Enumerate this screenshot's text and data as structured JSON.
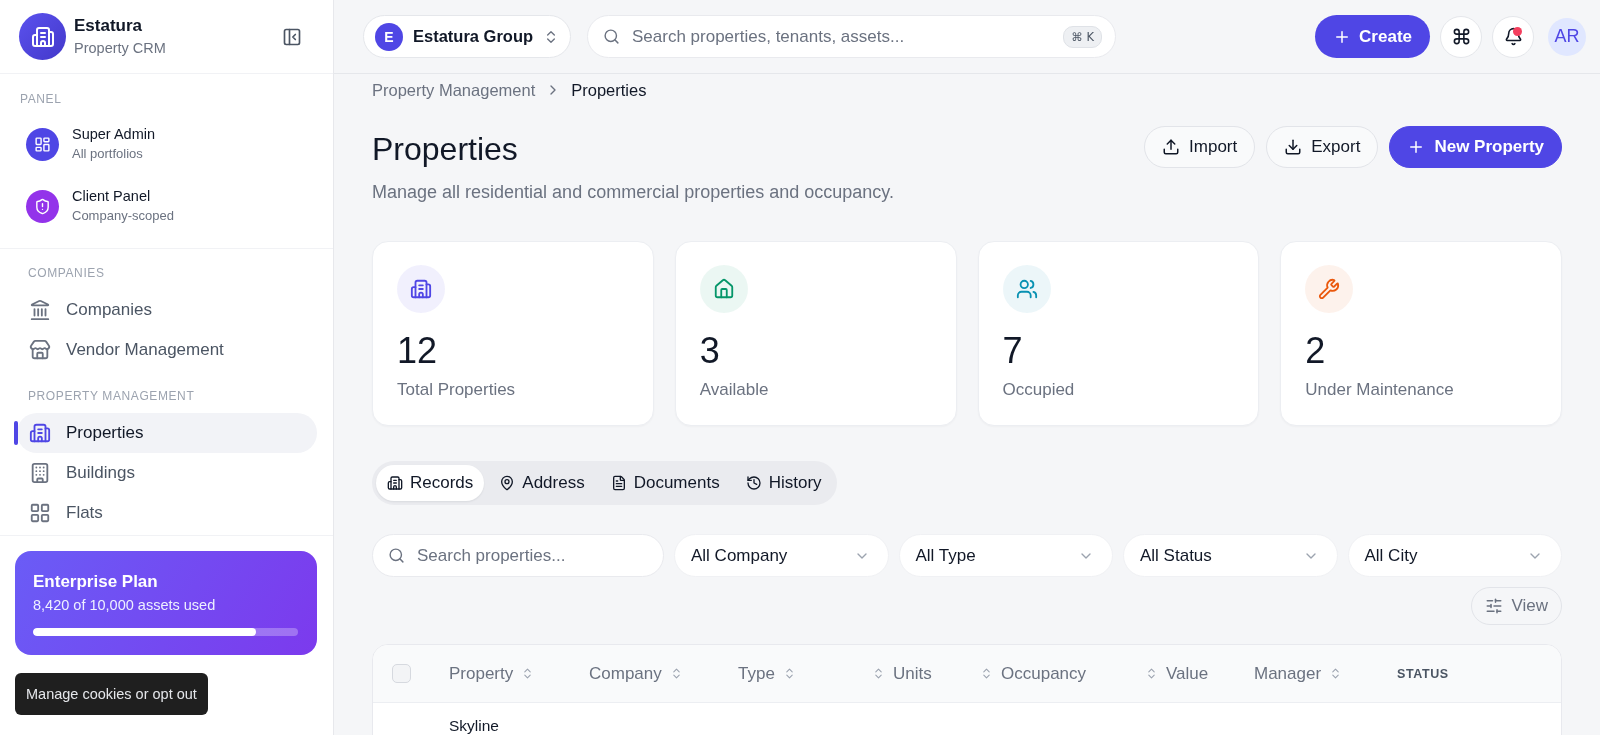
{
  "sidebar": {
    "brand": {
      "name": "Estatura",
      "subtitle": "Property CRM"
    },
    "panel_section": {
      "label": "PANEL",
      "items": [
        {
          "title": "Super Admin",
          "subtitle": "All portfolios",
          "color": "#4f46e5"
        },
        {
          "title": "Client Panel",
          "subtitle": "Company-scoped",
          "color": "#9333ea"
        }
      ]
    },
    "nav_sections": [
      {
        "label": "COMPANIES",
        "items": [
          {
            "label": "Companies",
            "selected": false
          },
          {
            "label": "Vendor Management",
            "selected": false
          }
        ]
      },
      {
        "label": "PROPERTY MANAGEMENT",
        "items": [
          {
            "label": "Properties",
            "selected": true
          },
          {
            "label": "Buildings",
            "selected": false
          },
          {
            "label": "Flats",
            "selected": false
          }
        ]
      }
    ],
    "plan": {
      "title": "Enterprise Plan",
      "usage": "8,420 of 10,000 assets used",
      "level": 0.842
    }
  },
  "cookie_notice": {
    "label": "Manage cookies or opt out"
  },
  "topbar": {
    "org": {
      "initial": "E",
      "name": "Estatura Group"
    },
    "search": {
      "placeholder": "Search properties, tenants, assets...",
      "shortcut": "⌘ K"
    },
    "create_button": "Create",
    "notifications_unread": true,
    "avatar": "AR"
  },
  "breadcrumb": [
    "Property Management",
    "Properties"
  ],
  "page": {
    "title": "Properties",
    "subtitle": "Manage all residential and commercial properties and occupancy.",
    "actions": [
      {
        "label": "Import",
        "kind": "import"
      },
      {
        "label": "Export",
        "kind": "export"
      },
      {
        "label": "New Property",
        "kind": "primary"
      }
    ]
  },
  "stats": [
    {
      "value": "12",
      "label": "Total Properties",
      "color": "#4f46e5"
    },
    {
      "value": "3",
      "label": "Available",
      "color": "#059669"
    },
    {
      "value": "7",
      "label": "Occupied",
      "color": "#0891b2"
    },
    {
      "value": "2",
      "label": "Under Maintenance",
      "color": "#ea580c"
    }
  ],
  "tabs": [
    {
      "label": "Records",
      "selected": true
    },
    {
      "label": "Address",
      "selected": false
    },
    {
      "label": "Documents",
      "selected": false
    },
    {
      "label": "History",
      "selected": false
    }
  ],
  "filters": {
    "search_placeholder": "Search properties...",
    "selects": [
      "All Company",
      "All Type",
      "All Status",
      "All City"
    ],
    "view_button": "View"
  },
  "table": {
    "select_all_checked": false,
    "columns": [
      {
        "label": "Property",
        "kind": "sort-after"
      },
      {
        "label": "Company",
        "kind": "sort-after"
      },
      {
        "label": "Type",
        "kind": "sort-after"
      },
      {
        "label": "Units",
        "kind": "sort-before"
      },
      {
        "label": "Occupancy",
        "kind": "sort-before"
      },
      {
        "label": "Value",
        "kind": "sort-before"
      },
      {
        "label": "Manager",
        "kind": "sort-after"
      },
      {
        "label": "STATUS",
        "kind": "plain"
      }
    ],
    "rows": [
      {
        "property": "Skyline"
      }
    ]
  }
}
